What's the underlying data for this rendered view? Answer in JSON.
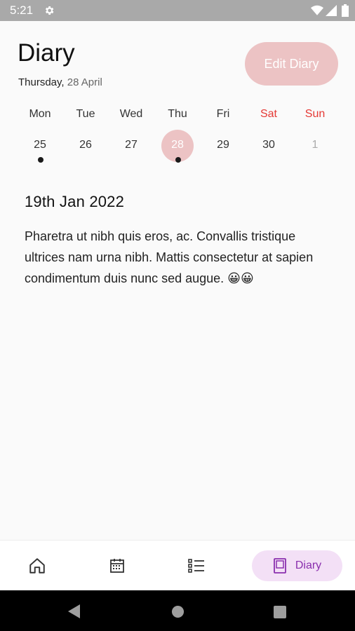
{
  "status_bar": {
    "time": "5:21",
    "icons": [
      "gear-icon",
      "wifi-icon",
      "signal-icon",
      "battery-icon"
    ]
  },
  "header": {
    "title": "Diary",
    "weekday": "Thursday,",
    "day": "28 April",
    "edit_label": "Edit Diary"
  },
  "week": {
    "weekdays": [
      "Mon",
      "Tue",
      "Wed",
      "Thu",
      "Fri",
      "Sat",
      "Sun"
    ],
    "dates": [
      "25",
      "26",
      "27",
      "28",
      "29",
      "30",
      "1"
    ],
    "selected_date": "28",
    "entries_on": [
      "25",
      "28"
    ]
  },
  "entry": {
    "date": "19th Jan 2022",
    "text": "Pharetra ut nibh quis eros, ac. Convallis tristique ultrices nam urna nibh. Mattis consectetur at sapien condimentum duis nunc sed augue. 😀😀"
  },
  "bottom_nav": {
    "items": [
      "home-icon",
      "calendar-icon",
      "list-icon",
      "diary-icon"
    ],
    "diary_label": "Diary",
    "active": "Diary"
  },
  "colors": {
    "accent_pink": "#ecc3c4",
    "weekend_red": "#e53935",
    "nav_active_bg": "#f3e0f6",
    "nav_active_text": "#8a2fae"
  }
}
